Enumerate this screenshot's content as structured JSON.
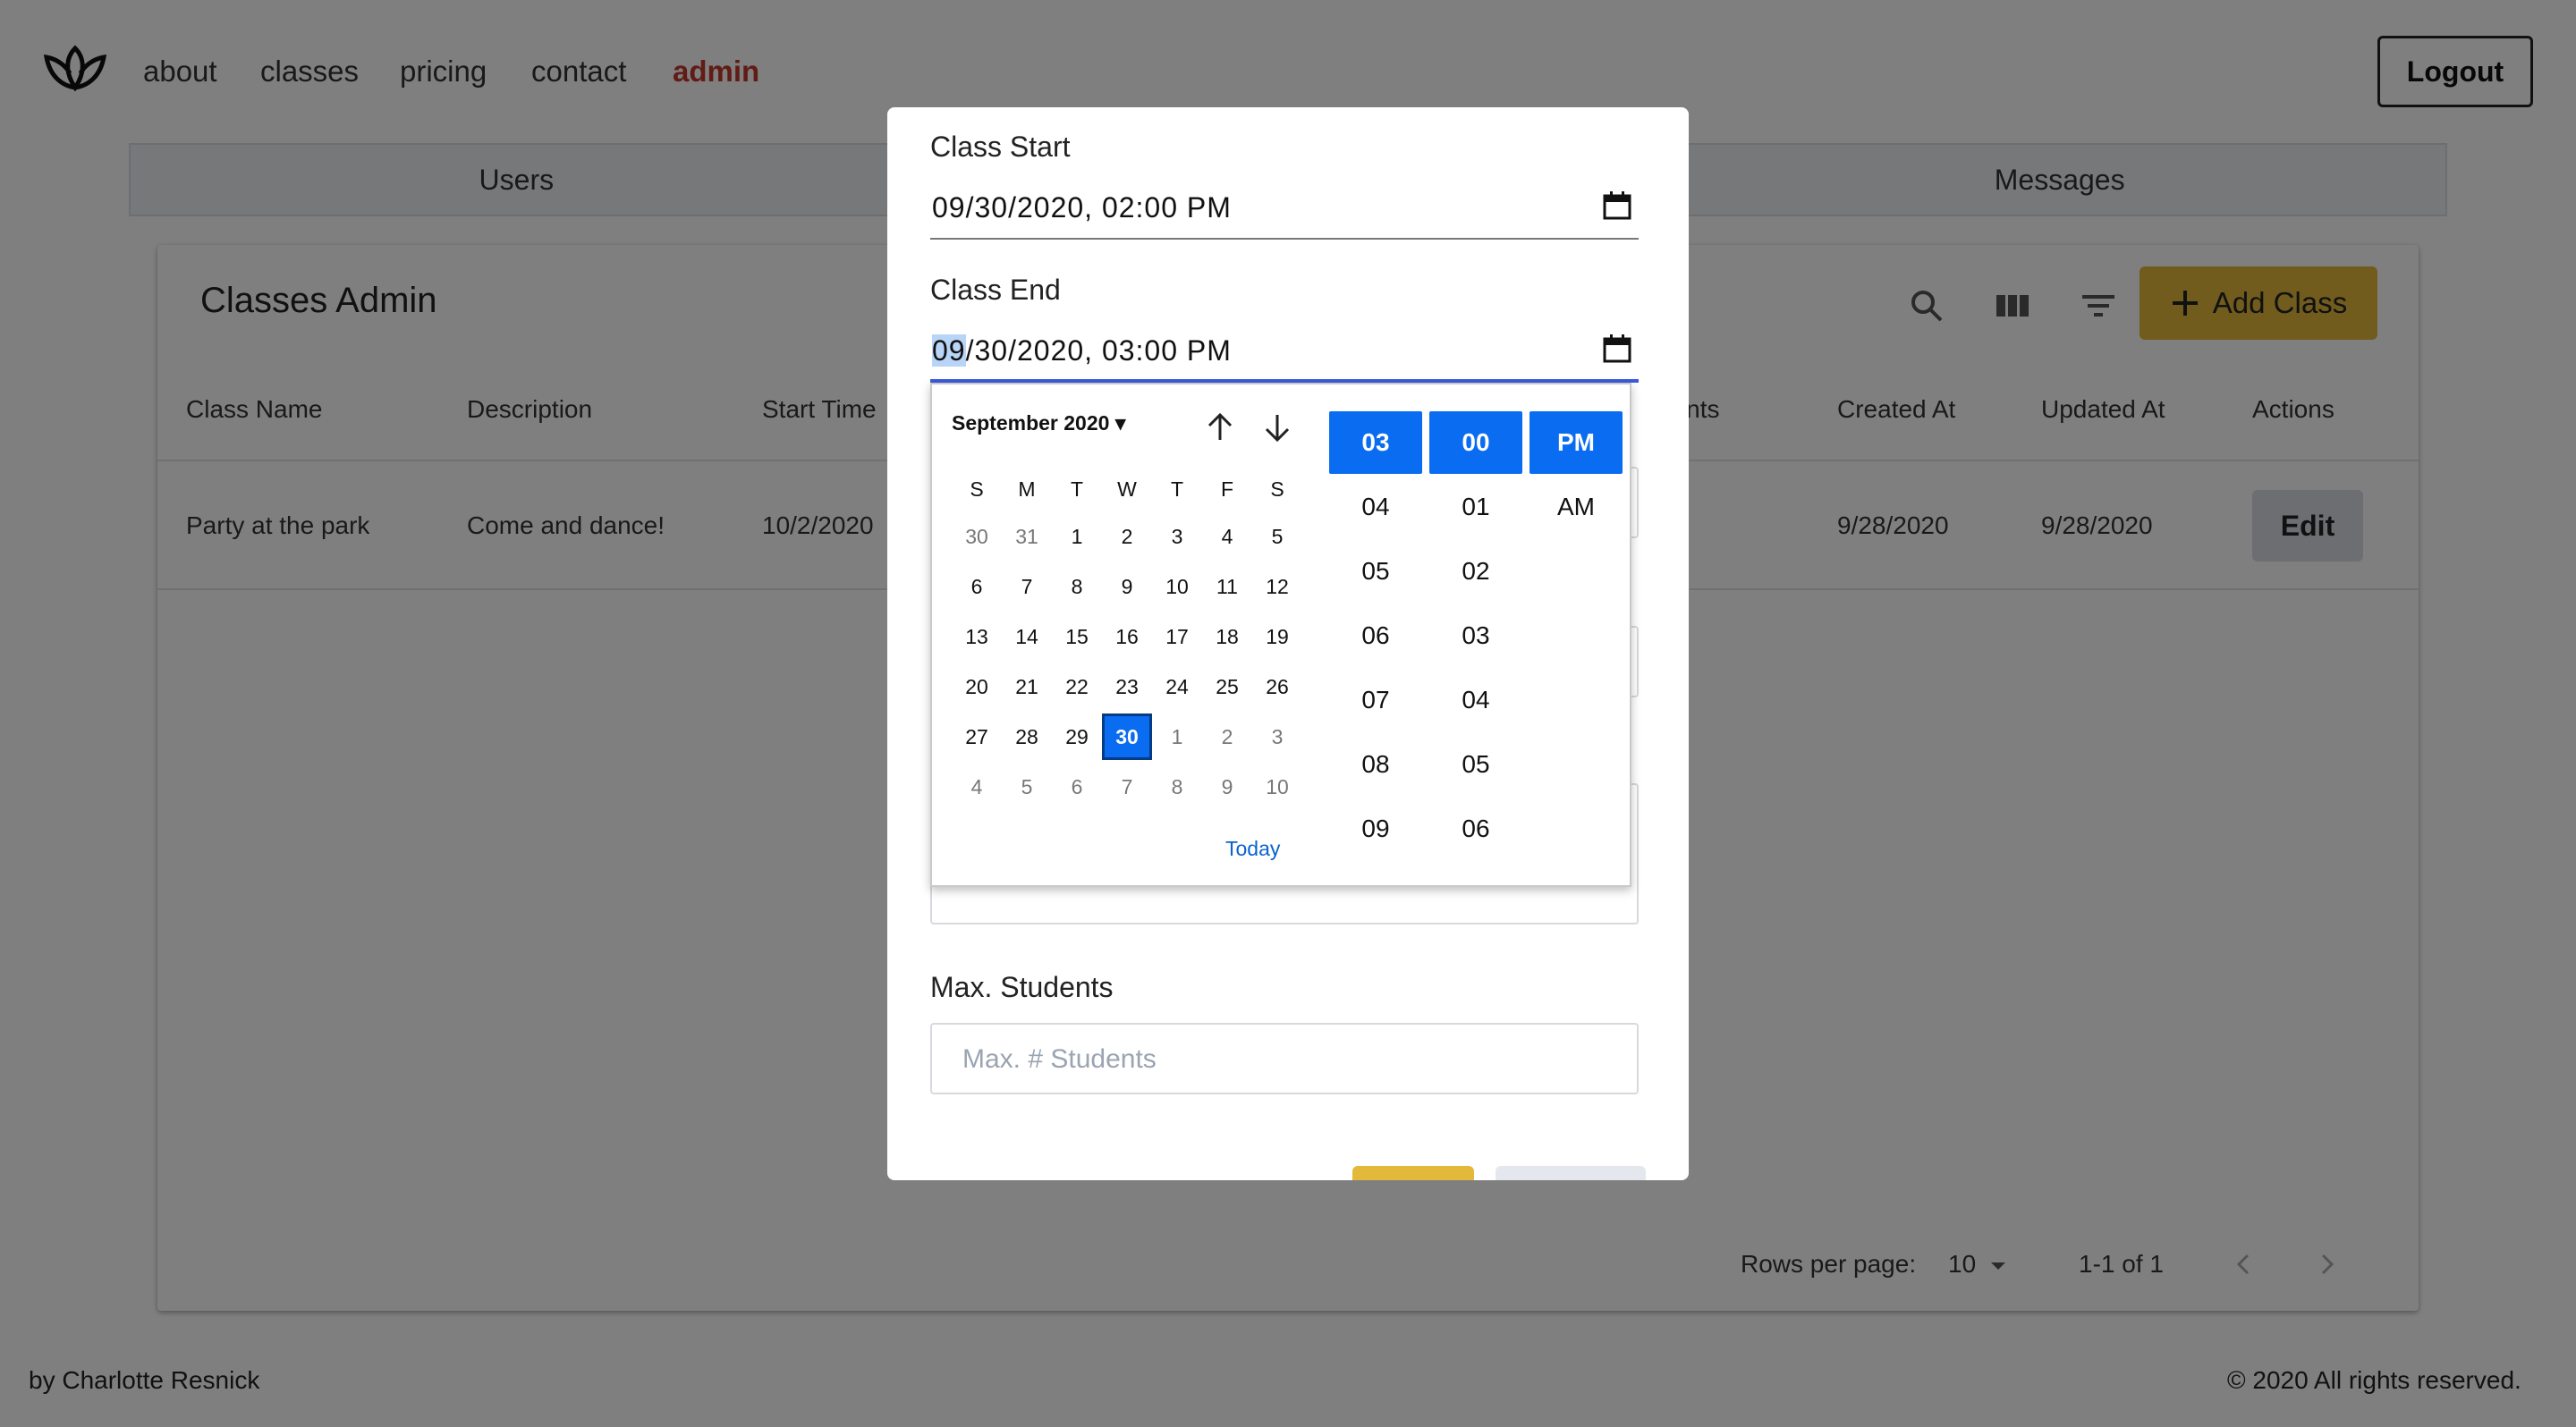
{
  "nav": {
    "links": [
      "about",
      "classes",
      "pricing",
      "contact"
    ],
    "admin": "admin",
    "logout": "Logout"
  },
  "tabs": [
    "Users",
    "Messages"
  ],
  "card": {
    "title": "Classes Admin",
    "add_class": "Add Class",
    "columns": [
      "Class Name",
      "Description",
      "Start Time",
      "dents",
      "Created At",
      "Updated At",
      "Actions"
    ],
    "rows": [
      {
        "name": "Party at the park",
        "description": "Come and dance!",
        "start": "10/2/2020",
        "created": "9/28/2020",
        "updated": "9/28/2020",
        "action": "Edit"
      }
    ],
    "pagination": {
      "rows_per_page_label": "Rows per page:",
      "rows_per_page": "10",
      "range": "1-1 of 1"
    }
  },
  "footer": {
    "left": "by Charlotte Resnick",
    "right": "© 2020 All rights reserved."
  },
  "modal": {
    "class_start_label": "Class Start",
    "class_start_value": "09/30/2020, 02:00 PM",
    "class_end_label": "Class End",
    "class_end_month": "09",
    "class_end_rest": "/30/2020, 03:00 PM",
    "max_students_label": "Max. Students",
    "max_students_placeholder": "Max. # Students"
  },
  "picker": {
    "month_label": "September 2020",
    "weekdays": [
      "S",
      "M",
      "T",
      "W",
      "T",
      "F",
      "S"
    ],
    "weeks": [
      [
        "30",
        "31",
        "1",
        "2",
        "3",
        "4",
        "5"
      ],
      [
        "6",
        "7",
        "8",
        "9",
        "10",
        "11",
        "12"
      ],
      [
        "13",
        "14",
        "15",
        "16",
        "17",
        "18",
        "19"
      ],
      [
        "20",
        "21",
        "22",
        "23",
        "24",
        "25",
        "26"
      ],
      [
        "27",
        "28",
        "29",
        "30",
        "1",
        "2",
        "3"
      ],
      [
        "4",
        "5",
        "6",
        "7",
        "8",
        "9",
        "10"
      ]
    ],
    "today": "Today",
    "hours": [
      "03",
      "04",
      "05",
      "06",
      "07",
      "08",
      "09"
    ],
    "minutes": [
      "00",
      "01",
      "02",
      "03",
      "04",
      "05",
      "06"
    ],
    "ampm": [
      "PM",
      "AM"
    ]
  }
}
